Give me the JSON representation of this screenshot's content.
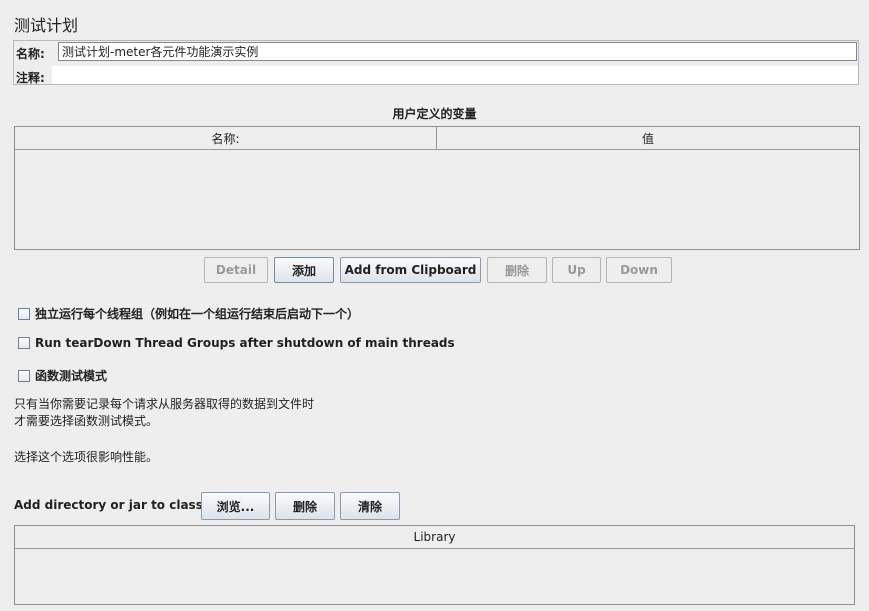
{
  "panel": {
    "title": "测试计划"
  },
  "name_field": {
    "label": "名称:",
    "value": "测试计划-meter各元件功能演示实例"
  },
  "comment_field": {
    "label": "注释:",
    "value": ""
  },
  "variables": {
    "title": "用户定义的变量",
    "columns": [
      "名称:",
      "值"
    ],
    "buttons": {
      "detail": "Detail",
      "add": "添加",
      "add_clipboard": "Add from Clipboard",
      "delete": "删除",
      "up": "Up",
      "down": "Down"
    }
  },
  "options": {
    "independent": {
      "label": "独立运行每个线程组（例如在一个组运行结束后启动下一个）",
      "checked": false
    },
    "teardown": {
      "label": "Run tearDown Thread Groups after shutdown of main threads",
      "checked": false
    },
    "functional": {
      "label": "函数测试模式",
      "checked": false
    }
  },
  "help_text": {
    "line1": "只有当你需要记录每个请求从服务器取得的数据到文件时",
    "line2": "才需要选择函数测试模式。",
    "line3": "选择这个选项很影响性能。"
  },
  "classpath": {
    "label": "Add directory or jar to classpath",
    "browse": "浏览...",
    "delete": "删除",
    "clear": "清除",
    "library_header": "Library"
  }
}
